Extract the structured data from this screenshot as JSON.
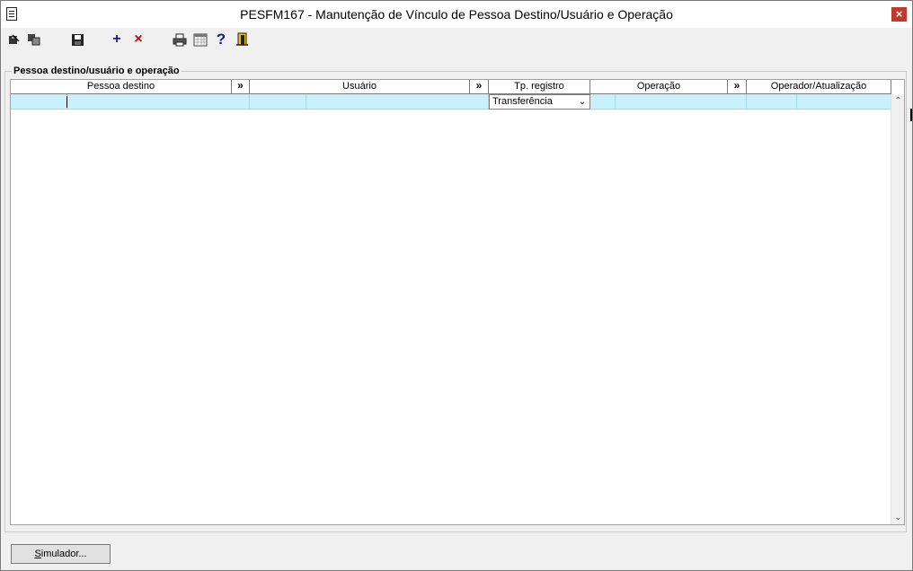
{
  "window": {
    "title": "PESFM167 - Manutenção de Vínculo de Pessoa Destino/Usuário e Operação",
    "close_glyph": "×"
  },
  "toolbar": {
    "icons": [
      "select-icon",
      "copy-icon",
      "save-icon",
      "add-icon",
      "delete-icon",
      "print-icon",
      "calendar-grid-icon",
      "help-icon",
      "exit-icon"
    ],
    "add_glyph": "+",
    "delete_glyph": "×",
    "help_glyph": "?"
  },
  "group": {
    "legend": "Pessoa destino/usuário e operação"
  },
  "grid": {
    "columns": [
      {
        "label": "Pessoa destino"
      },
      {
        "label": "»"
      },
      {
        "label": "Usuário"
      },
      {
        "label": "»"
      },
      {
        "label": "Tp. registro"
      },
      {
        "label": "Operação"
      },
      {
        "label": "»"
      },
      {
        "label": "Operador/Atualização"
      }
    ],
    "row": {
      "tp_registro": "Transferência",
      "combo_arrow": "⌄"
    },
    "scroll_up": "⌃",
    "scroll_down": "⌄"
  },
  "footer": {
    "simulator_button_underlined": "S",
    "simulator_button_rest": "imulador..."
  },
  "colors": {
    "selected_row": "#c9f1fb",
    "close_button": "#c0392b"
  }
}
